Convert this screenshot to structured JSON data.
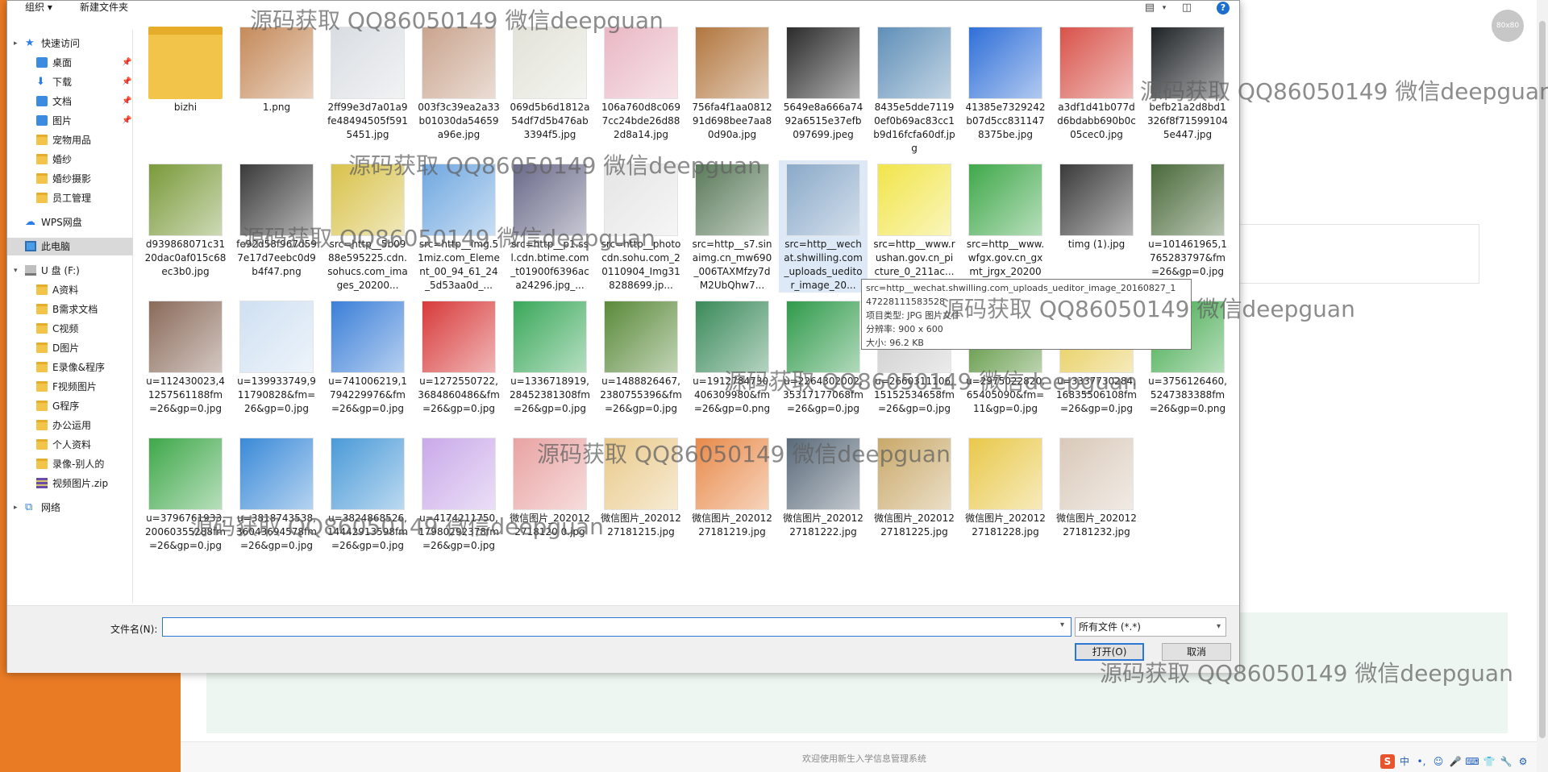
{
  "background": {
    "footer_text": "欢迎使用新生入学信息管理系统",
    "avatar_text": "80x80",
    "colors": {
      "sidebar": "#e97b25",
      "panel": "#eef6f2"
    }
  },
  "dialog": {
    "toolbar": {
      "organize": "组织 ▾",
      "new_folder": "新建文件夹"
    },
    "nav": [
      {
        "label": "快速访问",
        "icon": "star-icon",
        "type": "star",
        "indent": 0,
        "caret": "▸"
      },
      {
        "label": "桌面",
        "icon": "desktop-icon",
        "type": "blue",
        "indent": 1,
        "pin": "📌"
      },
      {
        "label": "下载",
        "icon": "download-icon",
        "type": "down",
        "indent": 1,
        "pin": "📌"
      },
      {
        "label": "文档",
        "icon": "document-icon",
        "type": "blue",
        "indent": 1,
        "pin": "📌"
      },
      {
        "label": "图片",
        "icon": "picture-icon",
        "type": "blue",
        "indent": 1,
        "pin": "📌"
      },
      {
        "label": "宠物用品",
        "icon": "folder-icon",
        "type": "folder",
        "indent": 1
      },
      {
        "label": "婚纱",
        "icon": "folder-icon",
        "type": "folder",
        "indent": 1
      },
      {
        "label": "婚纱摄影",
        "icon": "folder-icon",
        "type": "folder",
        "indent": 1
      },
      {
        "label": "员工管理",
        "icon": "folder-icon",
        "type": "folder",
        "indent": 1
      },
      {
        "label": "WPS网盘",
        "icon": "cloud-icon",
        "type": "cloud",
        "indent": 0,
        "gap": true
      },
      {
        "label": "此电脑",
        "icon": "computer-icon",
        "type": "pc",
        "indent": 0,
        "gap": true,
        "selected": true
      },
      {
        "label": "U 盘 (F:)",
        "icon": "drive-icon",
        "type": "drive",
        "indent": 0,
        "gap": true,
        "caret": "▾"
      },
      {
        "label": "A资料",
        "icon": "folder-icon",
        "type": "folder",
        "indent": 1
      },
      {
        "label": "B需求文档",
        "icon": "folder-icon",
        "type": "folder",
        "indent": 1
      },
      {
        "label": "C视频",
        "icon": "folder-icon",
        "type": "folder",
        "indent": 1
      },
      {
        "label": "D图片",
        "icon": "folder-icon",
        "type": "folder",
        "indent": 1
      },
      {
        "label": "E录像&程序",
        "icon": "folder-icon",
        "type": "folder",
        "indent": 1
      },
      {
        "label": "F视频图片",
        "icon": "folder-icon",
        "type": "folder",
        "indent": 1
      },
      {
        "label": "G程序",
        "icon": "folder-icon",
        "type": "folder",
        "indent": 1
      },
      {
        "label": "办公运用",
        "icon": "folder-icon",
        "type": "folder",
        "indent": 1
      },
      {
        "label": "个人资料",
        "icon": "folder-icon",
        "type": "folder",
        "indent": 1
      },
      {
        "label": "录像-别人的",
        "icon": "folder-icon",
        "type": "folder",
        "indent": 1
      },
      {
        "label": "视频图片.zip",
        "icon": "zip-icon",
        "type": "zip",
        "indent": 1
      },
      {
        "label": "网络",
        "icon": "network-icon",
        "type": "net",
        "indent": 0,
        "gap": true,
        "caret": "▸"
      }
    ],
    "files": [
      [
        {
          "name": "bizhi",
          "color": "#f3c44a",
          "kind": "folder"
        },
        {
          "name": "1.png",
          "color": "#c58a5a"
        },
        {
          "name": "2ff99e3d7a01a9fe48494505f5915451.jpg",
          "color": "#d9dde2"
        },
        {
          "name": "003f3c39ea2a33b01030da54659a96e.jpg",
          "color": "#c9a48e"
        },
        {
          "name": "069d5b6d1812a54df7d5b476ab3394f5.jpg",
          "color": "#e2e2d8"
        },
        {
          "name": "106a760d8c0697cc24bde26d882d8a14.jpg",
          "color": "#e9b7c4"
        },
        {
          "name": "756fa4f1aa081291d698bee7aa80d90a.jpg",
          "color": "#b2763e"
        },
        {
          "name": "5649e8a666a7492a6515e37efb097699.jpeg",
          "color": "#2b2b2b"
        },
        {
          "name": "8435e5dde71190ef0b69ac83cc1b9d16fcfa60df.jpg",
          "color": "#5f8fb8"
        },
        {
          "name": "41385e7329242b07d5cc8311478375be.jpg",
          "color": "#2f6fd8"
        },
        {
          "name": "a3df1d41b077dd6bdabb690b0c05cec0.jpg",
          "color": "#d8524a"
        },
        {
          "name": "befb21a2d8bd1326f8f715991045e447.jpg",
          "color": "#1f2326"
        }
      ],
      [
        {
          "name": "d939868071c3120dac0af015c68ec3b0.jpg",
          "color": "#7a9a3a"
        },
        {
          "name": "fe92d58f967d597e17d7eebc0d9b4f47.png",
          "color": "#3a3a3a"
        },
        {
          "name": "src=http__5b0988e595225.cdn.sohucs.com_images_20200...",
          "color": "#d8c24a"
        },
        {
          "name": "src=http__img.51miz.com_Element_00_94_61_24_5d53aa0d_...",
          "color": "#6fa7e0"
        },
        {
          "name": "src=http__p1.ssl.cdn.btime.com_t01900f6396aca24296.jpg_...",
          "color": "#6a6a8a"
        },
        {
          "name": "src=http__photocdn.sohu.com_20110904_Img318288699.jp...",
          "color": "#e5e5e5"
        },
        {
          "name": "src=http__s7.sinaimg.cn_mw690_006TAXMfzy7dM2UbQhw7...",
          "color": "#5a7a5a"
        },
        {
          "name": "src=http__wechat.shwilling.com_uploads_ueditor_image_20...",
          "color": "#8aa9c9",
          "selected": true
        },
        {
          "name": "src=http__www.rushan.gov.cn_picture_0_211ac...",
          "color": "#f1e54a"
        },
        {
          "name": "src=http__www.wfgx.gov.cn_gxmt_jrgx_202004...",
          "color": "#3fa84a"
        },
        {
          "name": "timg (1).jpg",
          "color": "#3a3a3a"
        },
        {
          "name": "u=101461965,1765283797&fm=26&gp=0.jpg",
          "color": "#4a6a3a"
        }
      ],
      [
        {
          "name": "u=112430023,41257561188fm=26&gp=0.jpg",
          "color": "#8a6a5a"
        },
        {
          "name": "u=139933749,911790828&fm=26&gp=0.jpg",
          "color": "#cfe0f2"
        },
        {
          "name": "u=741006219,1794229976&fm=26&gp=0.jpg",
          "color": "#3b7fd8"
        },
        {
          "name": "u=1272550722,3684860486&fm=26&gp=0.jpg",
          "color": "#d83a3a"
        },
        {
          "name": "u=1336718919,28452381308fm=26&gp=0.jpg",
          "color": "#3aa85a"
        },
        {
          "name": "u=1488826467,2380755396&fm=26&gp=0.jpg",
          "color": "#5a8a3a"
        },
        {
          "name": "u=1912784730,406309980&fm=26&gp=0.png",
          "color": "#3a8a5a"
        },
        {
          "name": "u=2264302002,35317177068fm=26&gp=0.jpg",
          "color": "#2f9a4a"
        },
        {
          "name": "u=2660311106,15152534658fm=26&gp=0.jpg",
          "color": "#c9c9c9"
        },
        {
          "name": "u=2975022820,65405090&fm=11&gp=0.jpg",
          "color": "#4a8a2a"
        },
        {
          "name": "u=3337730284,16835506108fm=26&gp=0.jpg",
          "color": "#e5c84a"
        },
        {
          "name": "u=3756126460,5247383388fm=26&gp=0.png",
          "color": "#3fa84a"
        }
      ],
      [
        {
          "name": "u=3796761933,20060355288fm=26&gp=0.jpg",
          "color": "#3fa84a"
        },
        {
          "name": "u=3818743538,36043694578fm=26&gp=0.jpg",
          "color": "#3a8ad8"
        },
        {
          "name": "u=3824868526,14442913598fm=26&gp=0.jpg",
          "color": "#4a9ad8"
        },
        {
          "name": "u=4174211750,17980292378fm=26&gp=0.jpg",
          "color": "#c9a9e9"
        },
        {
          "name": "微信图片_2020122718120 0.jpg",
          "color": "#e9a2a2"
        },
        {
          "name": "微信图片_20201227181215.jpg",
          "color": "#e9c98a"
        },
        {
          "name": "微信图片_20201227181219.jpg",
          "color": "#e98a4a"
        },
        {
          "name": "微信图片_20201227181222.jpg",
          "color": "#5a6a7a"
        },
        {
          "name": "微信图片_20201227181225.jpg",
          "color": "#c9a96a"
        },
        {
          "name": "微信图片_20201227181228.jpg",
          "color": "#e9c84a"
        },
        {
          "name": "微信图片_20201227181232.jpg",
          "color": "#d9c9b9"
        }
      ]
    ],
    "tooltip": {
      "line1": "src=http__wechat.shwilling.com_uploads_ueditor_image_20160827_1",
      "line2": "47228111583528",
      "line3": "项目类型: JPG 图片文件",
      "line4": "分辨率: 900 x 600",
      "line5": "大小: 96.2 KB"
    },
    "bottom": {
      "filename_label": "文件名(N):",
      "filename_value": "",
      "filter": "所有文件 (*.*)",
      "open": "打开(O)",
      "cancel": "取消"
    }
  },
  "watermark": "源码获取 QQ86050149 微信deepguan",
  "tray": [
    "中",
    "•,",
    "☺",
    "🎤",
    "⌨",
    "👕",
    "🔧",
    "⚙"
  ]
}
